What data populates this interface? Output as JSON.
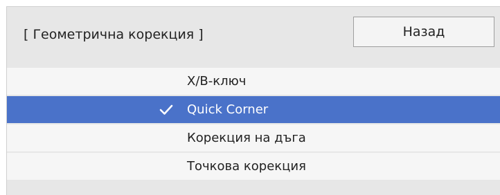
{
  "header": {
    "title": "[ Геометрична корекция ]",
    "back_label": "Назад"
  },
  "menu": {
    "items": [
      {
        "label": "Х/В-ключ",
        "selected": false
      },
      {
        "label": "Quick Corner",
        "selected": true,
        "icon": "checkmark-icon"
      },
      {
        "label": "Корекция на дъга",
        "selected": false
      },
      {
        "label": "Точкова корекция",
        "selected": false
      }
    ]
  },
  "colors": {
    "panel_background": "#e7e7e7",
    "item_background": "#f6f6f6",
    "selected_background": "#4a72c9",
    "selected_text": "#ffffff"
  }
}
